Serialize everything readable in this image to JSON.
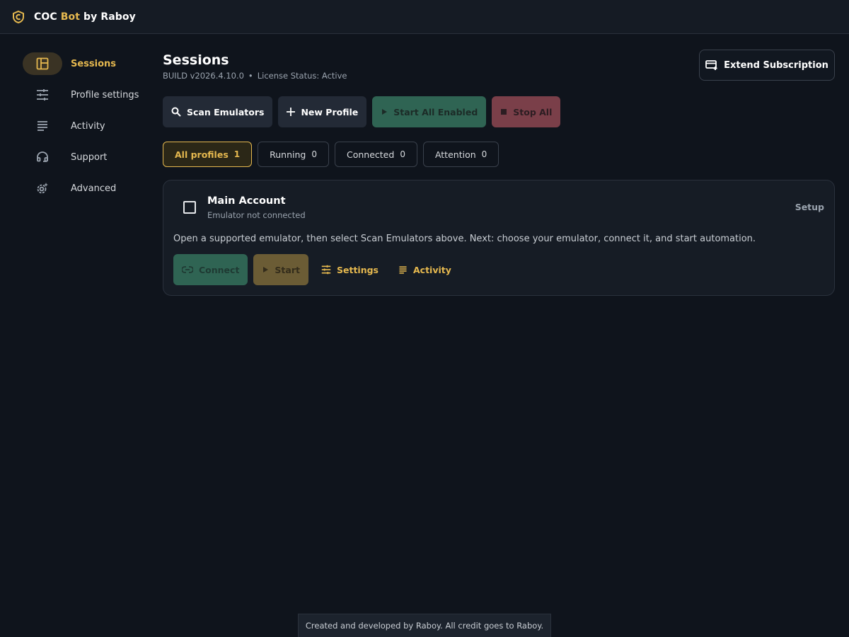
{
  "app": {
    "brand_prefix": "COC ",
    "brand_accent": "Bot",
    "brand_suffix": " by Raboy",
    "accent_color": "#e5b84f"
  },
  "sidebar": {
    "items": [
      {
        "label": "Sessions",
        "icon": "dashboard-icon",
        "active": true
      },
      {
        "label": "Profile settings",
        "icon": "sliders-icon",
        "active": false
      },
      {
        "label": "Activity",
        "icon": "list-icon",
        "active": false
      },
      {
        "label": "Support",
        "icon": "headset-icon",
        "active": false
      },
      {
        "label": "Advanced",
        "icon": "gear-sparkle-icon",
        "active": false
      }
    ]
  },
  "header": {
    "title": "Sessions",
    "build": "BUILD v2026.4.10.0",
    "separator": "•",
    "license": "License Status: Active",
    "extend_label": "Extend Subscription"
  },
  "actions": {
    "scan_label": "Scan Emulators",
    "new_profile_label": "New Profile",
    "start_all_label": "Start All Enabled",
    "stop_all_label": "Stop All"
  },
  "filters": [
    {
      "label": "All profiles",
      "count": "1",
      "active": true
    },
    {
      "label": "Running",
      "count": "0",
      "active": false
    },
    {
      "label": "Connected",
      "count": "0",
      "active": false
    },
    {
      "label": "Attention",
      "count": "0",
      "active": false
    }
  ],
  "profile": {
    "name": "Main Account",
    "status": "Emulator not connected",
    "setup_label": "Setup",
    "description": "Open a supported emulator, then select Scan Emulators above. Next: choose your emulator, connect it, and start automation.",
    "connect_label": "Connect",
    "start_label": "Start",
    "settings_label": "Settings",
    "activity_label": "Activity"
  },
  "footer": {
    "credit": "Created and developed by Raboy. All credit goes to Raboy."
  }
}
